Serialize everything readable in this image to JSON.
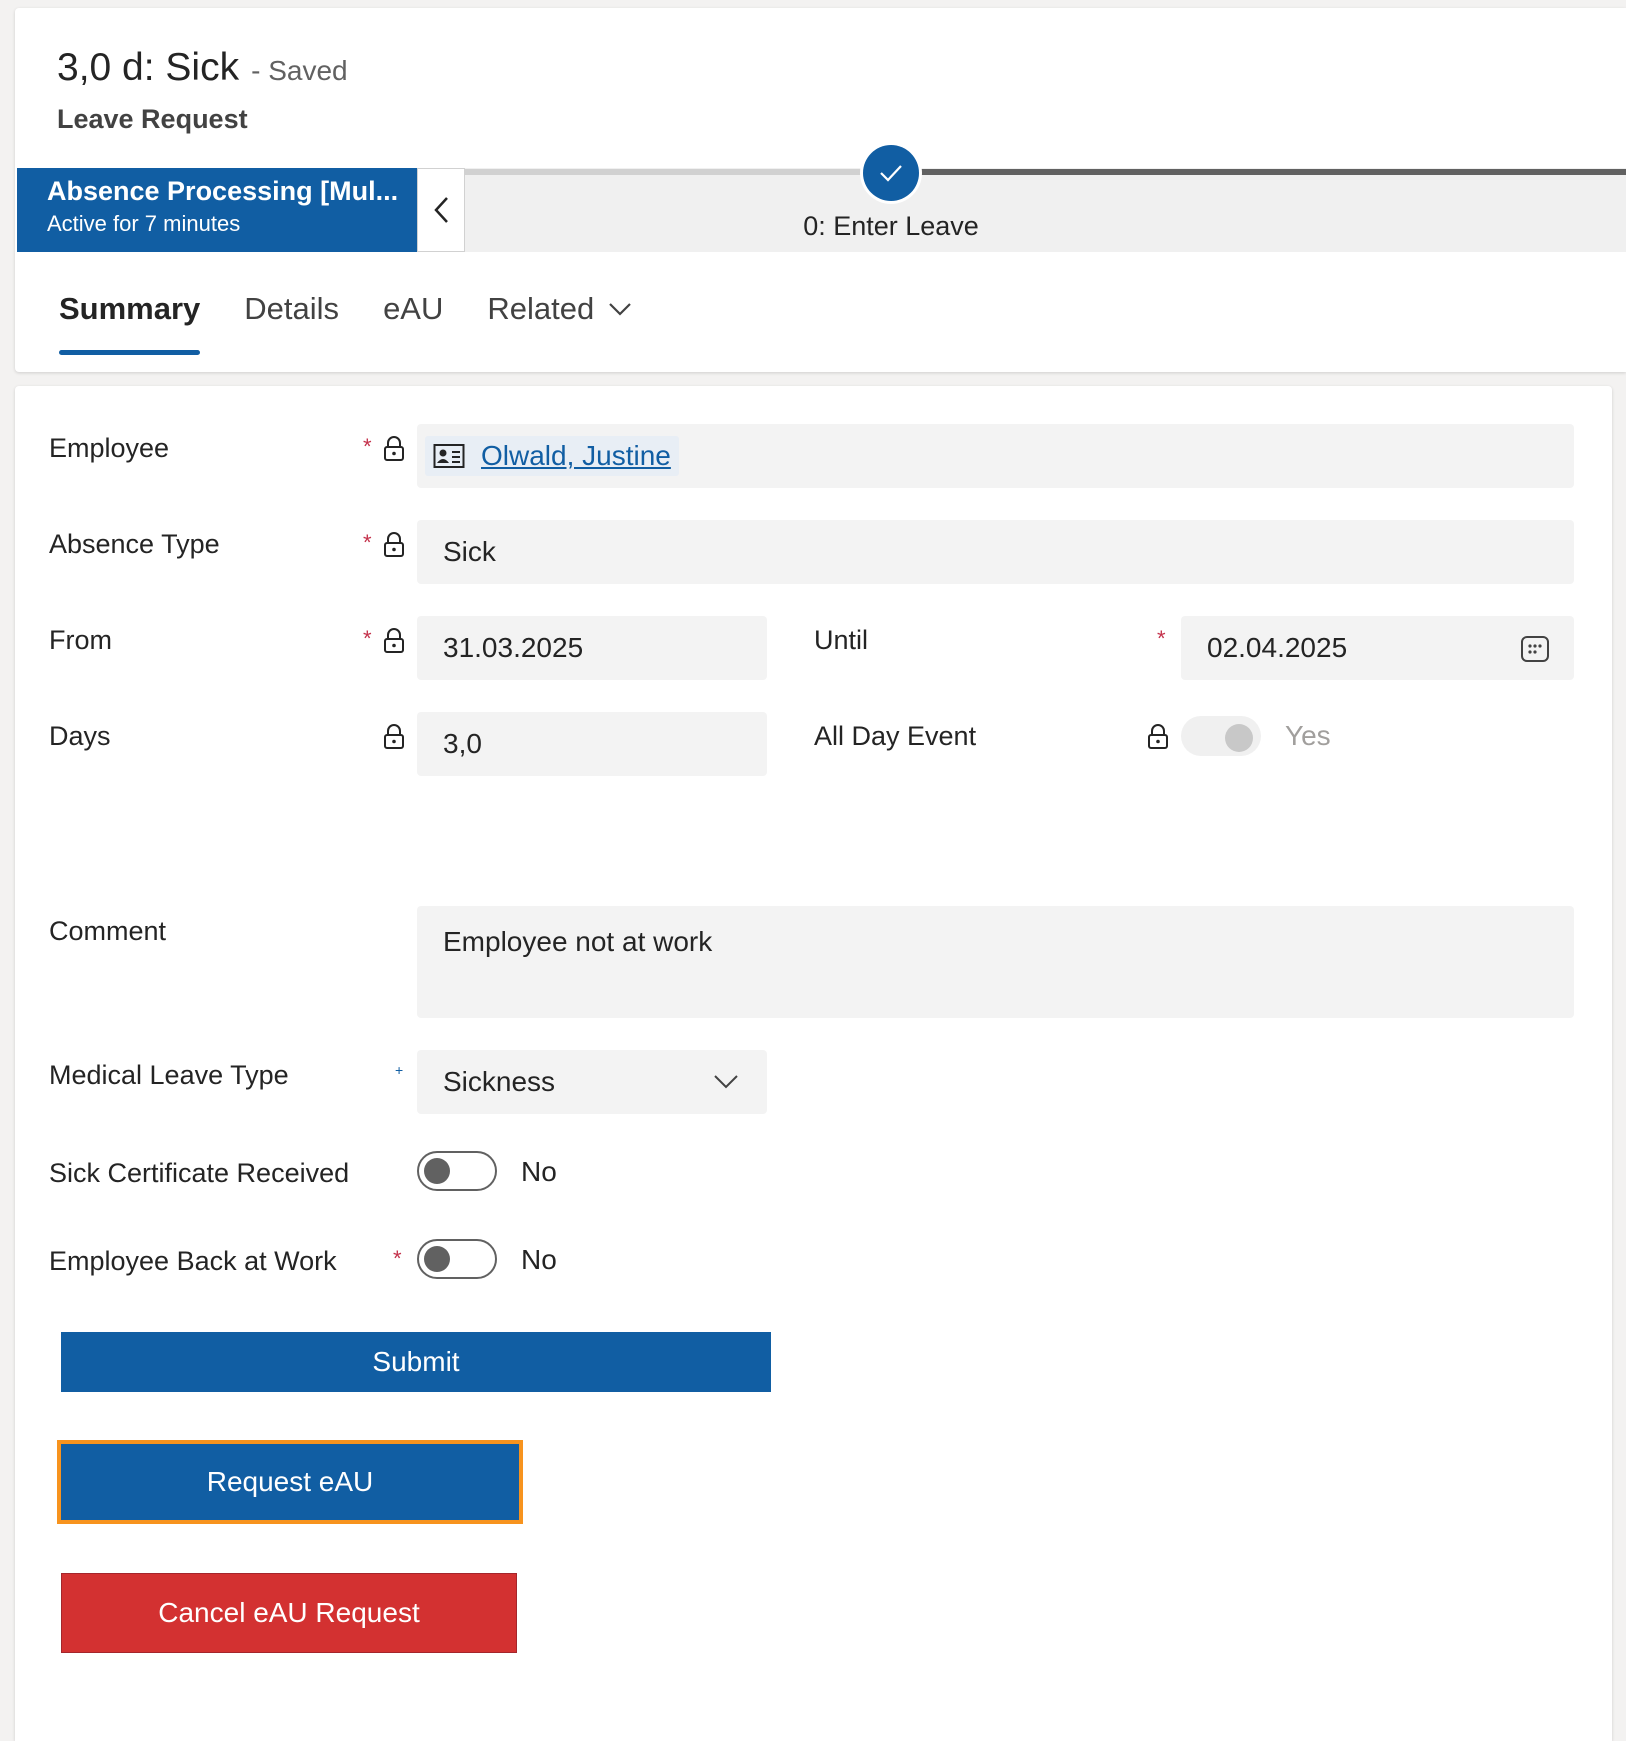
{
  "header": {
    "title": "3,0 d: Sick",
    "status": "- Saved",
    "entity": "Leave Request"
  },
  "bpf": {
    "process_name": "Absence Processing [Mul...",
    "active_for": "Active for 7 minutes",
    "stage_label": "0: Enter Leave"
  },
  "tabs": [
    {
      "label": "Summary",
      "active": true
    },
    {
      "label": "Details"
    },
    {
      "label": "eAU"
    },
    {
      "label": "Related"
    }
  ],
  "form": {
    "employee": {
      "label": "Employee",
      "value": "Olwald, Justine"
    },
    "absence_type": {
      "label": "Absence Type",
      "value": "Sick"
    },
    "from": {
      "label": "From",
      "value": "31.03.2025"
    },
    "until": {
      "label": "Until",
      "value": "02.04.2025"
    },
    "days": {
      "label": "Days",
      "value": "3,0"
    },
    "all_day_event": {
      "label": "All Day Event",
      "value": "Yes"
    },
    "comment": {
      "label": "Comment",
      "value": "Employee not at work"
    },
    "medical_leave_type": {
      "label": "Medical Leave Type",
      "value": "Sickness"
    },
    "sick_certificate_received": {
      "label": "Sick Certificate Received",
      "value": "No"
    },
    "employee_back_at_work": {
      "label": "Employee Back at Work",
      "value": "No"
    },
    "required_mark": "*",
    "recommended_mark": "+"
  },
  "buttons": {
    "submit": "Submit",
    "request_eau": "Request eAU",
    "cancel_eau": "Cancel eAU Request"
  },
  "colors": {
    "primary": "#115ea3",
    "danger": "#d33131",
    "focus": "#f7931e",
    "required": "#c4314b"
  }
}
